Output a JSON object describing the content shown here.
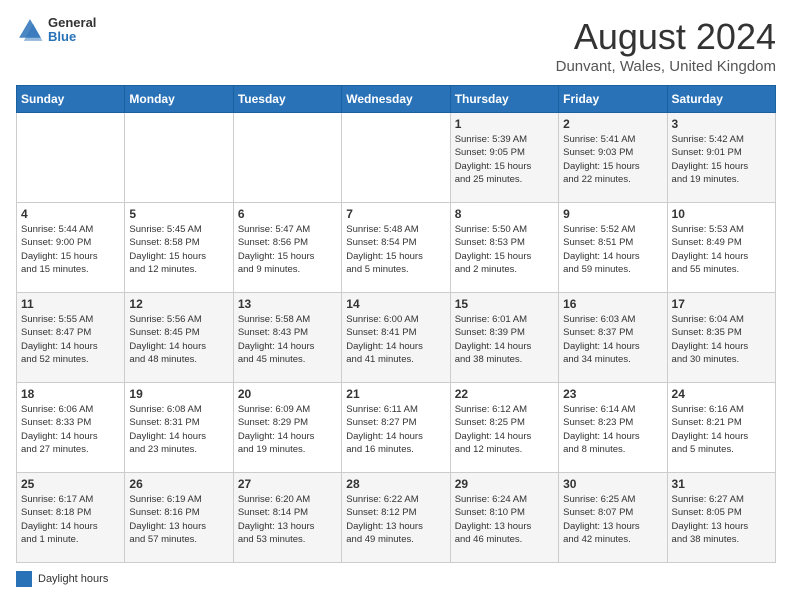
{
  "header": {
    "logo_line1": "General",
    "logo_line2": "Blue",
    "title": "August 2024",
    "subtitle": "Dunvant, Wales, United Kingdom"
  },
  "days_of_week": [
    "Sunday",
    "Monday",
    "Tuesday",
    "Wednesday",
    "Thursday",
    "Friday",
    "Saturday"
  ],
  "weeks": [
    [
      {
        "day": "",
        "info": ""
      },
      {
        "day": "",
        "info": ""
      },
      {
        "day": "",
        "info": ""
      },
      {
        "day": "",
        "info": ""
      },
      {
        "day": "1",
        "info": "Sunrise: 5:39 AM\nSunset: 9:05 PM\nDaylight: 15 hours\nand 25 minutes."
      },
      {
        "day": "2",
        "info": "Sunrise: 5:41 AM\nSunset: 9:03 PM\nDaylight: 15 hours\nand 22 minutes."
      },
      {
        "day": "3",
        "info": "Sunrise: 5:42 AM\nSunset: 9:01 PM\nDaylight: 15 hours\nand 19 minutes."
      }
    ],
    [
      {
        "day": "4",
        "info": "Sunrise: 5:44 AM\nSunset: 9:00 PM\nDaylight: 15 hours\nand 15 minutes."
      },
      {
        "day": "5",
        "info": "Sunrise: 5:45 AM\nSunset: 8:58 PM\nDaylight: 15 hours\nand 12 minutes."
      },
      {
        "day": "6",
        "info": "Sunrise: 5:47 AM\nSunset: 8:56 PM\nDaylight: 15 hours\nand 9 minutes."
      },
      {
        "day": "7",
        "info": "Sunrise: 5:48 AM\nSunset: 8:54 PM\nDaylight: 15 hours\nand 5 minutes."
      },
      {
        "day": "8",
        "info": "Sunrise: 5:50 AM\nSunset: 8:53 PM\nDaylight: 15 hours\nand 2 minutes."
      },
      {
        "day": "9",
        "info": "Sunrise: 5:52 AM\nSunset: 8:51 PM\nDaylight: 14 hours\nand 59 minutes."
      },
      {
        "day": "10",
        "info": "Sunrise: 5:53 AM\nSunset: 8:49 PM\nDaylight: 14 hours\nand 55 minutes."
      }
    ],
    [
      {
        "day": "11",
        "info": "Sunrise: 5:55 AM\nSunset: 8:47 PM\nDaylight: 14 hours\nand 52 minutes."
      },
      {
        "day": "12",
        "info": "Sunrise: 5:56 AM\nSunset: 8:45 PM\nDaylight: 14 hours\nand 48 minutes."
      },
      {
        "day": "13",
        "info": "Sunrise: 5:58 AM\nSunset: 8:43 PM\nDaylight: 14 hours\nand 45 minutes."
      },
      {
        "day": "14",
        "info": "Sunrise: 6:00 AM\nSunset: 8:41 PM\nDaylight: 14 hours\nand 41 minutes."
      },
      {
        "day": "15",
        "info": "Sunrise: 6:01 AM\nSunset: 8:39 PM\nDaylight: 14 hours\nand 38 minutes."
      },
      {
        "day": "16",
        "info": "Sunrise: 6:03 AM\nSunset: 8:37 PM\nDaylight: 14 hours\nand 34 minutes."
      },
      {
        "day": "17",
        "info": "Sunrise: 6:04 AM\nSunset: 8:35 PM\nDaylight: 14 hours\nand 30 minutes."
      }
    ],
    [
      {
        "day": "18",
        "info": "Sunrise: 6:06 AM\nSunset: 8:33 PM\nDaylight: 14 hours\nand 27 minutes."
      },
      {
        "day": "19",
        "info": "Sunrise: 6:08 AM\nSunset: 8:31 PM\nDaylight: 14 hours\nand 23 minutes."
      },
      {
        "day": "20",
        "info": "Sunrise: 6:09 AM\nSunset: 8:29 PM\nDaylight: 14 hours\nand 19 minutes."
      },
      {
        "day": "21",
        "info": "Sunrise: 6:11 AM\nSunset: 8:27 PM\nDaylight: 14 hours\nand 16 minutes."
      },
      {
        "day": "22",
        "info": "Sunrise: 6:12 AM\nSunset: 8:25 PM\nDaylight: 14 hours\nand 12 minutes."
      },
      {
        "day": "23",
        "info": "Sunrise: 6:14 AM\nSunset: 8:23 PM\nDaylight: 14 hours\nand 8 minutes."
      },
      {
        "day": "24",
        "info": "Sunrise: 6:16 AM\nSunset: 8:21 PM\nDaylight: 14 hours\nand 5 minutes."
      }
    ],
    [
      {
        "day": "25",
        "info": "Sunrise: 6:17 AM\nSunset: 8:18 PM\nDaylight: 14 hours\nand 1 minute."
      },
      {
        "day": "26",
        "info": "Sunrise: 6:19 AM\nSunset: 8:16 PM\nDaylight: 13 hours\nand 57 minutes."
      },
      {
        "day": "27",
        "info": "Sunrise: 6:20 AM\nSunset: 8:14 PM\nDaylight: 13 hours\nand 53 minutes."
      },
      {
        "day": "28",
        "info": "Sunrise: 6:22 AM\nSunset: 8:12 PM\nDaylight: 13 hours\nand 49 minutes."
      },
      {
        "day": "29",
        "info": "Sunrise: 6:24 AM\nSunset: 8:10 PM\nDaylight: 13 hours\nand 46 minutes."
      },
      {
        "day": "30",
        "info": "Sunrise: 6:25 AM\nSunset: 8:07 PM\nDaylight: 13 hours\nand 42 minutes."
      },
      {
        "day": "31",
        "info": "Sunrise: 6:27 AM\nSunset: 8:05 PM\nDaylight: 13 hours\nand 38 minutes."
      }
    ]
  ],
  "legend": {
    "color_label": "Daylight hours"
  }
}
